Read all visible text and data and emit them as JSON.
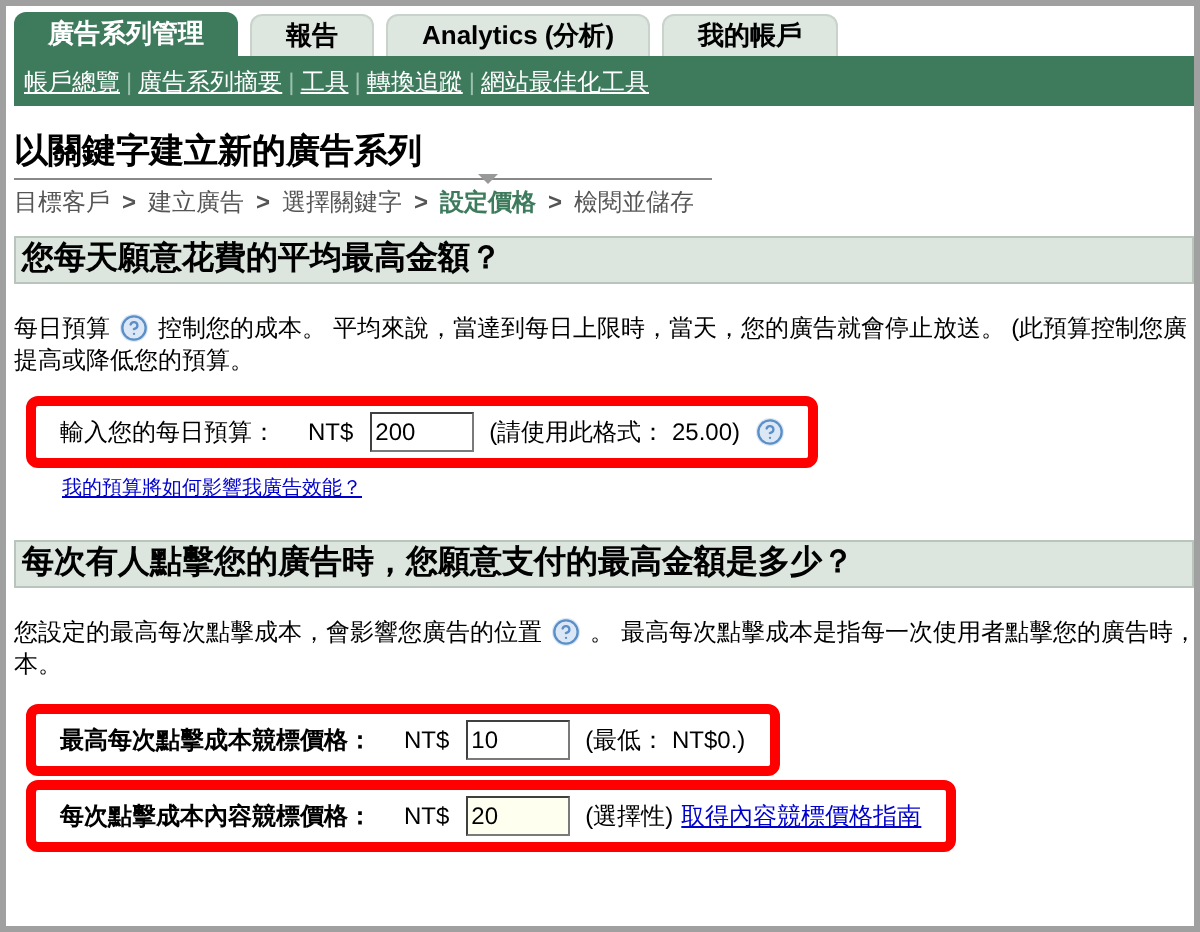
{
  "tabs": [
    {
      "label": "廣告系列管理",
      "selected": true
    },
    {
      "label": "報告",
      "selected": false
    },
    {
      "label": "Analytics (分析)",
      "selected": false
    },
    {
      "label": "我的帳戶",
      "selected": false
    }
  ],
  "subnav": [
    "帳戶總覽",
    "廣告系列摘要",
    "工具",
    "轉換追蹤",
    "網站最佳化工具"
  ],
  "subnav_separator": "|",
  "page_title": "以關鍵字建立新的廣告系列",
  "breadcrumb": {
    "separator": ">",
    "steps": [
      {
        "label": "目標客戶",
        "selected": false
      },
      {
        "label": "建立廣告",
        "selected": false
      },
      {
        "label": "選擇關鍵字",
        "selected": false
      },
      {
        "label": "設定價格",
        "selected": true
      },
      {
        "label": "檢閱並儲存",
        "selected": false
      }
    ]
  },
  "sections": [
    {
      "heading": "您每天願意花費的平均最高金額？",
      "paragraph": {
        "before_help": "每日預算",
        "after_help": "控制您的成本。 平均來說，當達到每日上限時，當天，您的廣告就會停止放送。 (此預算控制您廣",
        "line_2": "提高或降低您的預算。"
      },
      "fields": [
        {
          "label": "輸入您的每日預算：",
          "bold": false,
          "currency": "NT$",
          "value": "200",
          "highlighted": false,
          "note": "(請使用此格式： 25.00)",
          "help": true
        }
      ],
      "link": "我的預算將如何影響我廣告效能？"
    },
    {
      "heading": "每次有人點擊您的廣告時，您願意支付的最高金額是多少？",
      "paragraph": {
        "before_help": "您設定的最高每次點擊成本，會影響您廣告的位置",
        "after_help": "。 最高每次點擊成本是指每一次使用者點擊您的廣告時，",
        "line_2": "本。"
      },
      "fields": [
        {
          "label": "最高每次點擊成本競標價格：",
          "bold": true,
          "currency": "NT$",
          "value": "10",
          "highlighted": false,
          "note": "(最低： NT$0.)",
          "help": false
        },
        {
          "label": "每次點擊成本內容競標價格：",
          "bold": true,
          "currency": "NT$",
          "value": "20",
          "highlighted": true,
          "note": "(選擇性)",
          "note_link": "取得內容競標價格指南",
          "help": false
        }
      ]
    }
  ]
}
